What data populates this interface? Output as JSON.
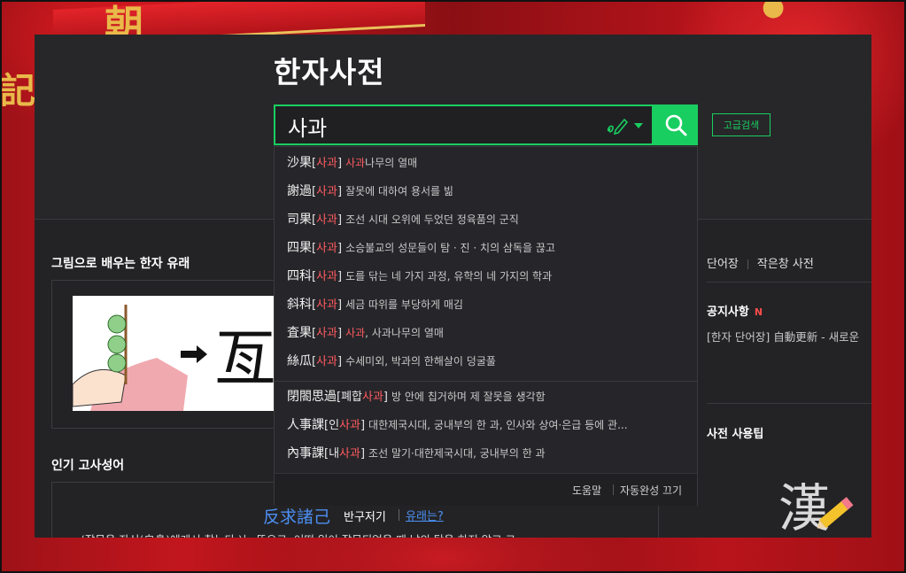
{
  "app": {
    "title": "한자사전"
  },
  "search": {
    "value": "사과",
    "advanced_label": "고급검색"
  },
  "autocomplete": {
    "items": [
      {
        "hanja": "沙果",
        "reading": "사과",
        "desc_pre": "",
        "desc_hl": "사과",
        "desc_post": "나무의 열매"
      },
      {
        "hanja": "謝過",
        "reading": "사과",
        "desc_pre": "잘못에 대하여 용서를 빎",
        "desc_hl": "",
        "desc_post": ""
      },
      {
        "hanja": "司果",
        "reading": "사과",
        "desc_pre": "조선 시대 오위에 두었던 정육품의 군직",
        "desc_hl": "",
        "desc_post": ""
      },
      {
        "hanja": "四果",
        "reading": "사과",
        "desc_pre": "소승불교의 성문들이 탐 · 진 · 치의 삼독을 끊고",
        "desc_hl": "",
        "desc_post": ""
      },
      {
        "hanja": "四科",
        "reading": "사과",
        "desc_pre": "도를 닦는 네 가지 과정, 유학의 네 가지의 학과",
        "desc_hl": "",
        "desc_post": ""
      },
      {
        "hanja": "斜科",
        "reading": "사과",
        "desc_pre": "세금 따위를 부당하게 매김",
        "desc_hl": "",
        "desc_post": ""
      },
      {
        "hanja": "査果",
        "reading": "사과",
        "desc_pre": "",
        "desc_hl": "사과",
        "desc_post": ", 사과나무의 열매"
      },
      {
        "hanja": "絲瓜",
        "reading": "사과",
        "desc_pre": "수세미외, 박과의 한해살이 덩굴풀",
        "desc_hl": "",
        "desc_post": ""
      },
      {
        "hanja": "閉閤思過",
        "reading_pre": "폐합",
        "reading": "사과",
        "desc_pre": "방 안에 칩거하며 제 잘못을 생각함",
        "desc_hl": "",
        "desc_post": ""
      },
      {
        "hanja": "人事課",
        "reading_pre": "인",
        "reading": "사과",
        "desc_pre": "대한제국시대, 궁내부의 한 과, 인사와 상여·은급 등에 관...",
        "desc_hl": "",
        "desc_post": ""
      },
      {
        "hanja": "內事課",
        "reading_pre": "내",
        "reading": "사과",
        "desc_pre": "조선 말기·대한제국시대, 궁내부의 한 과",
        "desc_hl": "",
        "desc_post": ""
      }
    ],
    "footer_help": "도움말",
    "footer_off": "자동완성 끄기"
  },
  "left": {
    "image_section_title": "그림으로 배우는 한자 유래",
    "proverb_section_title": "인기 고사성어",
    "proverb": {
      "hanja": "反求諸己",
      "reading": "반구저기",
      "link": "유래는?",
      "text": "(잘못을 자신(自身)에게서 찾는다.)는 뜻으로, 어떤 일이 잘못되었을 때 남의 탓을 하지 않고 그"
    }
  },
  "right": {
    "link_vocab": "단어장",
    "link_small": "작은창 사전",
    "notice_title": "공지사항",
    "notice_new": "N",
    "notice_text": "[한자 단어장] 自動更新 - 새로운",
    "tips_title": "사전 사용팁",
    "logo_char": "漢"
  },
  "colors": {
    "accent": "#19ce60",
    "highlight": "#ff5a5f",
    "link": "#4c8ff2",
    "panel": "#232326"
  }
}
